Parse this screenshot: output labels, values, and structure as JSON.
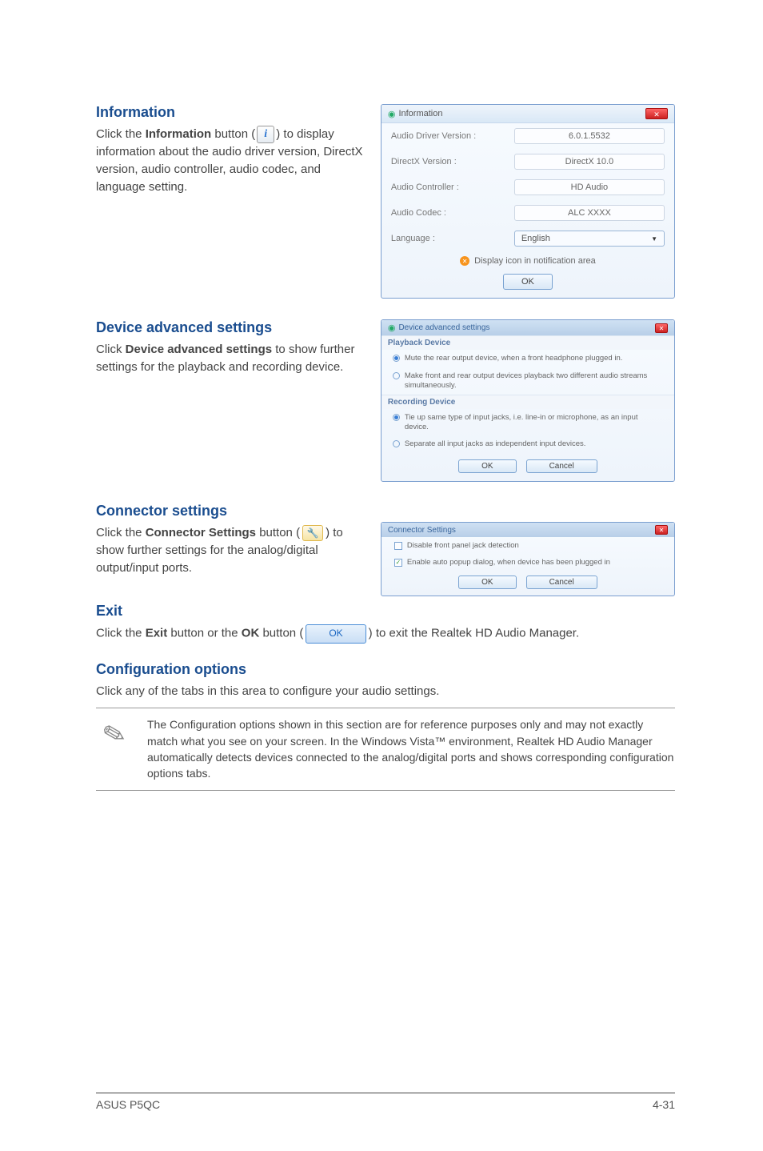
{
  "information": {
    "heading": "Information",
    "body_prefix": "Click the ",
    "body_bold": "Information",
    "body_mid": " button (",
    "body_after": ") to display information about the audio driver version, DirectX version, audio controller, audio codec, and language setting.",
    "dialog_title": "Information",
    "rows": [
      {
        "label": "Audio Driver Version :",
        "value": "6.0.1.5532"
      },
      {
        "label": "DirectX Version :",
        "value": "DirectX 10.0"
      },
      {
        "label": "Audio Controller :",
        "value": "HD Audio"
      },
      {
        "label": "Audio Codec :",
        "value": "ALC XXXX"
      }
    ],
    "lang_label": "Language :",
    "lang_value": "English",
    "notify_text": "Display icon in notification area",
    "ok": "OK",
    "icon_name": "info-icon"
  },
  "device_adv": {
    "heading": "Device advanced settings",
    "body_prefix": "Click ",
    "body_bold": "Device advanced settings",
    "body_after": " to show further settings for the playback and recording device.",
    "dialog_title": "Device advanced settings",
    "playback_header": "Playback Device",
    "playback_opt1": "Mute the rear output device, when a front headphone plugged in.",
    "playback_opt2": "Make front and rear output devices playback two different audio streams simultaneously.",
    "recording_header": "Recording Device",
    "recording_opt1": "Tie up same type of input jacks, i.e. line-in or microphone, as an input device.",
    "recording_opt2": "Separate all input jacks as independent input devices.",
    "ok": "OK",
    "cancel": "Cancel"
  },
  "connector": {
    "heading": "Connector settings",
    "body_prefix": "Click the ",
    "body_bold": "Connector Settings",
    "body_mid": " button (",
    "body_after": ") to show further settings for the analog/digital output/input ports.",
    "dialog_title": "Connector Settings",
    "opt1": "Disable front panel jack detection",
    "opt2": "Enable auto popup dialog, when device has been plugged in",
    "ok": "OK",
    "cancel": "Cancel",
    "icon_name": "wrench-icon"
  },
  "exit": {
    "heading": "Exit",
    "body_prefix": "Click the ",
    "body_bold1": "Exit",
    "body_mid1": " button or the ",
    "body_bold2": "OK",
    "body_mid2": " button (",
    "ok_label": "OK",
    "body_after": ") to exit the Realtek HD Audio Manager."
  },
  "config": {
    "heading": "Configuration options",
    "body": "Click any of the tabs in this area to configure your audio settings.",
    "note": "The Configuration options shown in this section are for reference purposes only and may not exactly match what you see on your screen. In the Windows Vista™ environment, Realtek HD Audio Manager automatically detects devices connected to the analog/digital ports and shows corresponding  configuration options tabs."
  },
  "footer": {
    "left": "ASUS P5QC",
    "right": "4-31"
  }
}
